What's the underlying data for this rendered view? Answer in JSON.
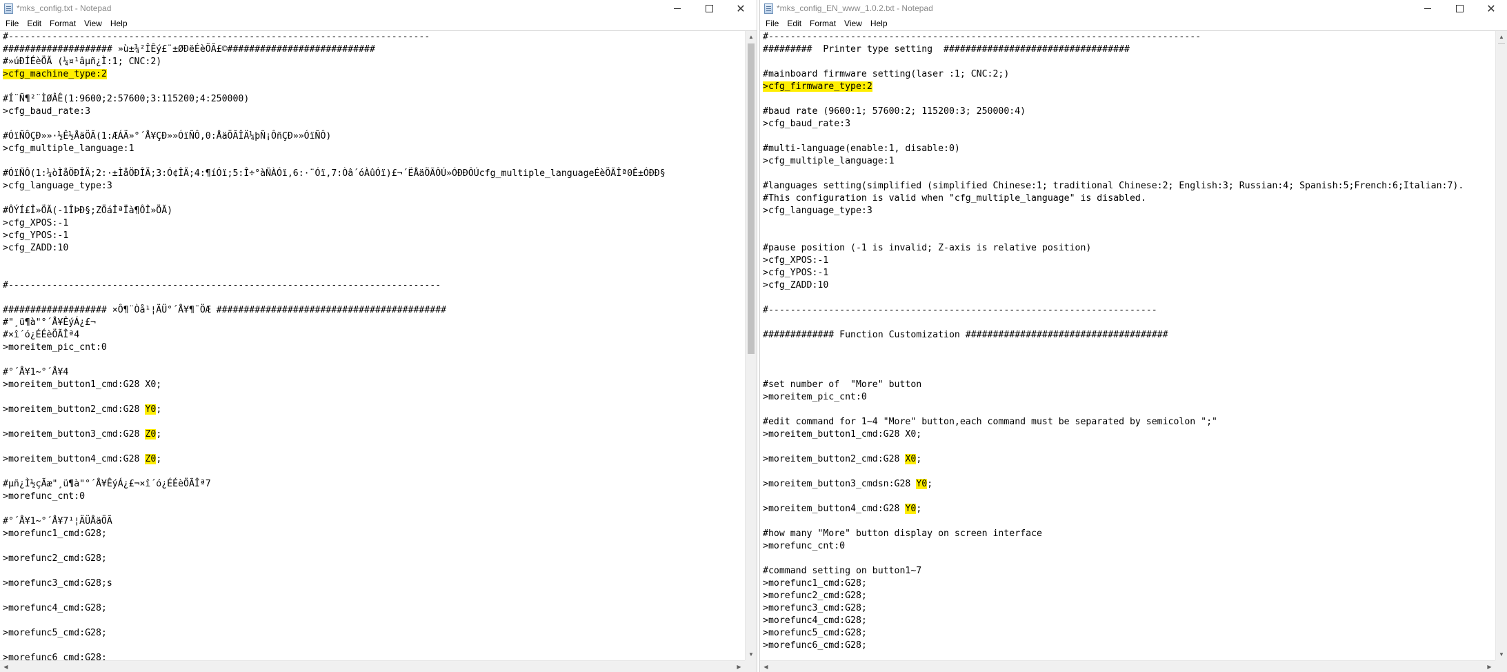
{
  "left_window": {
    "title": "*mks_config.txt - Notepad",
    "menu": [
      "File",
      "Edit",
      "Format",
      "View",
      "Help"
    ],
    "lines": [
      {
        "text": "#-----------------------------------------------------------------------------"
      },
      {
        "text": "#################### »ù±¾²ÎÊý£¨±ØÐëÉèÖÃ£©###########################"
      },
      {
        "text": "#»úÐÍÉèÖÃ (¼¤¹âµñ¿Ì:1; CNC:2)"
      },
      {
        "text": ">cfg_machine_type:2",
        "hl": "full"
      },
      {
        "text": ""
      },
      {
        "text": "#Í¨Ñ¶²¨ÌØÂÊ(1:9600;2:57600;3:115200;4:250000)"
      },
      {
        "text": ">cfg_baud_rate:3"
      },
      {
        "text": ""
      },
      {
        "text": "#ÓïÑÔÇÐ»»·½Ê½ÅäÖÃ(1:ÆÁÄ»°´Å¥ÇÐ»»ÓïÑÔ,0:ÅäÖÃÎÄ¼þÑ¡ÔñÇÐ»»ÓïÑÔ)"
      },
      {
        "text": ">cfg_multiple_language:1"
      },
      {
        "text": ""
      },
      {
        "text": "#ÓïÑÔ(1:¼òÌåÖÐÎÄ;2:·±ÌåÖÐÎÄ;3:Ó¢ÎÄ;4:¶íÓï;5:Î÷°àÑÀÓï,6:·¨Óï,7:Òâ´óÀûÓï)£¬´ËÅäÖÃÔÚ»ÓÐÐÔÚcfg_multiple_languageÉèÖÃÎª0Ê±ÓÐÐ§"
      },
      {
        "text": ">cfg_language_type:3"
      },
      {
        "text": ""
      },
      {
        "text": "#ÔÝÍ£Î»ÖÃ(-1ÎÞÐ§;ZÖáÎªÏà¶ÔÎ»ÖÃ)"
      },
      {
        "text": ">cfg_XPOS:-1"
      },
      {
        "text": ">cfg_YPOS:-1"
      },
      {
        "text": ">cfg_ZADD:10"
      },
      {
        "text": ""
      },
      {
        "text": ""
      },
      {
        "text": "#-------------------------------------------------------------------------------"
      },
      {
        "text": ""
      },
      {
        "text": "################### ×Ô¶¨Òå¹¦ÄÜ°´Å¥¶¨ÖÆ ##########################################"
      },
      {
        "text": "#\"¸ü¶à\"°´Å¥ÊýÁ¿£¬"
      },
      {
        "text": "#×î´ó¿ÉÉèÖÃÎª4"
      },
      {
        "text": ">moreitem_pic_cnt:0"
      },
      {
        "text": ""
      },
      {
        "text": "#°´Å¥1~°´Å¥4"
      },
      {
        "text": ">moreitem_button1_cmd:G28 X0;"
      },
      {
        "text": ""
      },
      {
        "text": ">moreitem_button2_cmd:G28 ",
        "hl_part": "Y0",
        "after": ";"
      },
      {
        "text": ""
      },
      {
        "text": ">moreitem_button3_cmd:G28 ",
        "hl_part": "Z0",
        "after": ";"
      },
      {
        "text": ""
      },
      {
        "text": ">moreitem_button4_cmd:G28 ",
        "hl_part": "Z0",
        "after": ";"
      },
      {
        "text": ""
      },
      {
        "text": "#µñ¿Ì½çÃæ\"¸ü¶à\"°´Å¥ÊýÁ¿£¬×î´ó¿ÉÉèÖÃÎª7"
      },
      {
        "text": ">morefunc_cnt:0"
      },
      {
        "text": ""
      },
      {
        "text": "#°´Å¥1~°´Å¥7¹¦ÄÜÅäÖÃ"
      },
      {
        "text": ">morefunc1_cmd:G28;"
      },
      {
        "text": ""
      },
      {
        "text": ">morefunc2_cmd:G28;"
      },
      {
        "text": ""
      },
      {
        "text": ">morefunc3_cmd:G28;s"
      },
      {
        "text": ""
      },
      {
        "text": ">morefunc4_cmd:G28;"
      },
      {
        "text": ""
      },
      {
        "text": ">morefunc5_cmd:G28;"
      },
      {
        "text": ""
      },
      {
        "text": ">morefunc6_cmd:G28;"
      }
    ]
  },
  "right_window": {
    "title": "*mks_config_EN_www_1.0.2.txt - Notepad",
    "menu": [
      "File",
      "Edit",
      "Format",
      "View",
      "Help"
    ],
    "lines": [
      {
        "text": "#-------------------------------------------------------------------------------"
      },
      {
        "text": "#########  Printer type setting  ##################################"
      },
      {
        "text": ""
      },
      {
        "text": "#mainboard firmware setting(laser :1; CNC:2;)"
      },
      {
        "text": ">cfg_firmware_type:2",
        "hl": "full"
      },
      {
        "text": ""
      },
      {
        "text": "#baud rate (9600:1; 57600:2; 115200:3; 250000:4)"
      },
      {
        "text": ">cfg_baud_rate:3"
      },
      {
        "text": ""
      },
      {
        "text": "#multi-language(enable:1, disable:0)"
      },
      {
        "text": ">cfg_multiple_language:1"
      },
      {
        "text": ""
      },
      {
        "text": "#languages setting(simplified (simplified Chinese:1; traditional Chinese:2; English:3; Russian:4; Spanish:5;French:6;Italian:7)."
      },
      {
        "text": "#This configuration is valid when \"cfg_multiple_language\" is disabled."
      },
      {
        "text": ">cfg_language_type:3"
      },
      {
        "text": ""
      },
      {
        "text": ""
      },
      {
        "text": "#pause position (-1 is invalid; Z-axis is relative position)"
      },
      {
        "text": ">cfg_XPOS:-1"
      },
      {
        "text": ">cfg_YPOS:-1"
      },
      {
        "text": ">cfg_ZADD:10"
      },
      {
        "text": ""
      },
      {
        "text": "#-----------------------------------------------------------------------"
      },
      {
        "text": ""
      },
      {
        "text": "############# Function Customization #####################################"
      },
      {
        "text": ""
      },
      {
        "text": ""
      },
      {
        "text": ""
      },
      {
        "text": "#set number of  \"More\" button"
      },
      {
        "text": ">moreitem_pic_cnt:0"
      },
      {
        "text": ""
      },
      {
        "text": "#edit command for 1~4 \"More\" button,each command must be separated by semicolon \";\""
      },
      {
        "text": ">moreitem_button1_cmd:G28 X0;"
      },
      {
        "text": ""
      },
      {
        "text": ">moreitem_button2_cmd:G28 ",
        "hl_part": "X0",
        "after": ";"
      },
      {
        "text": ""
      },
      {
        "text": ">moreitem_button3_cmdsn:G28 ",
        "hl_part": "Y0",
        "after": ";"
      },
      {
        "text": ""
      },
      {
        "text": ">moreitem_button4_cmd:G28 ",
        "hl_part": "Y0",
        "after": ";"
      },
      {
        "text": ""
      },
      {
        "text": "#how many \"More\" button display on screen interface"
      },
      {
        "text": ">morefunc_cnt:0"
      },
      {
        "text": ""
      },
      {
        "text": "#command setting on button1~7"
      },
      {
        "text": ">morefunc1_cmd:G28;"
      },
      {
        "text": ">morefunc2_cmd:G28;"
      },
      {
        "text": ">morefunc3_cmd:G28;"
      },
      {
        "text": ">morefunc4_cmd:G28;"
      },
      {
        "text": ">morefunc5_cmd:G28;"
      },
      {
        "text": ">morefunc6_cmd:G28;"
      }
    ]
  },
  "colors": {
    "highlight": "#ffee00"
  }
}
